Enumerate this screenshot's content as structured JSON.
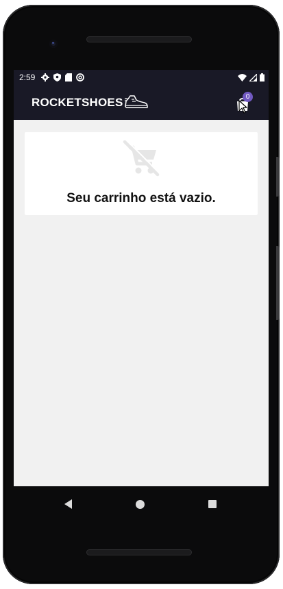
{
  "status_bar": {
    "time": "2:59",
    "left_icons": [
      "settings-icon",
      "shield-icon",
      "sd-card-icon",
      "sync-icon"
    ],
    "right_icons": [
      "wifi-icon",
      "signal-icon",
      "battery-icon"
    ]
  },
  "app_bar": {
    "brand": "ROCKETSHOES",
    "brand_icon": "running-shoe-icon",
    "cart_icon": "shopping-bag-icon",
    "cart_count": "0"
  },
  "empty_state": {
    "icon": "remove-shopping-cart-icon",
    "message": "Seu carrinho está vazio."
  },
  "nav_bar": {
    "buttons": [
      "back-button",
      "home-button",
      "recents-button"
    ]
  },
  "colors": {
    "header_bg": "#191926",
    "badge": "#7159c1",
    "screen_bg": "#f1f1f1",
    "card_bg": "#ffffff"
  }
}
